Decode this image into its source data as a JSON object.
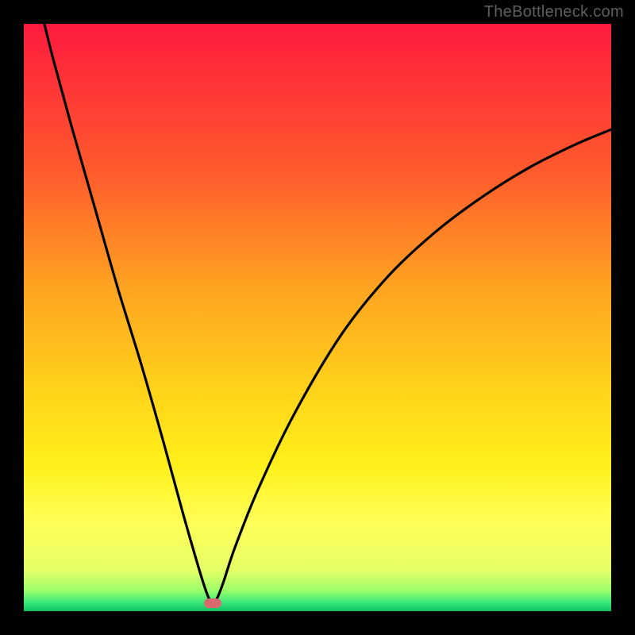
{
  "watermark": "TheBottleneck.com",
  "chart_data": {
    "type": "line",
    "title": "",
    "xlabel": "",
    "ylabel": "",
    "xlim": [
      0,
      100
    ],
    "ylim": [
      0,
      100
    ],
    "grid": false,
    "legend": false,
    "background_gradient": {
      "stops": [
        {
          "offset": 0.0,
          "color": "#ff1a3e"
        },
        {
          "offset": 0.25,
          "color": "#ff5a2d"
        },
        {
          "offset": 0.45,
          "color": "#ffa421"
        },
        {
          "offset": 0.62,
          "color": "#ffd21a"
        },
        {
          "offset": 0.75,
          "color": "#fff01a"
        },
        {
          "offset": 0.85,
          "color": "#ffff59"
        },
        {
          "offset": 0.93,
          "color": "#e6ff66"
        },
        {
          "offset": 0.965,
          "color": "#9bff6a"
        },
        {
          "offset": 0.985,
          "color": "#38e87a"
        },
        {
          "offset": 1.0,
          "color": "#0fbf63"
        }
      ]
    },
    "series": [
      {
        "name": "bottleneck-curve",
        "color": "#000000",
        "x": [
          3.5,
          5,
          8,
          12,
          16,
          20,
          24,
          27,
          29,
          30.5,
          31.5,
          32.2,
          33,
          34,
          36,
          40,
          46,
          54,
          62,
          70,
          78,
          86,
          94,
          100
        ],
        "y": [
          100,
          94,
          83,
          69,
          55,
          42,
          28,
          17,
          10,
          5,
          2.2,
          1.3,
          2.4,
          5,
          11,
          21,
          33.5,
          47,
          57,
          64.5,
          70.5,
          75.5,
          79.5,
          82
        ]
      }
    ],
    "marker": {
      "name": "optimal-point",
      "x": 32.2,
      "y": 1.3,
      "color": "#d86a6f"
    }
  }
}
